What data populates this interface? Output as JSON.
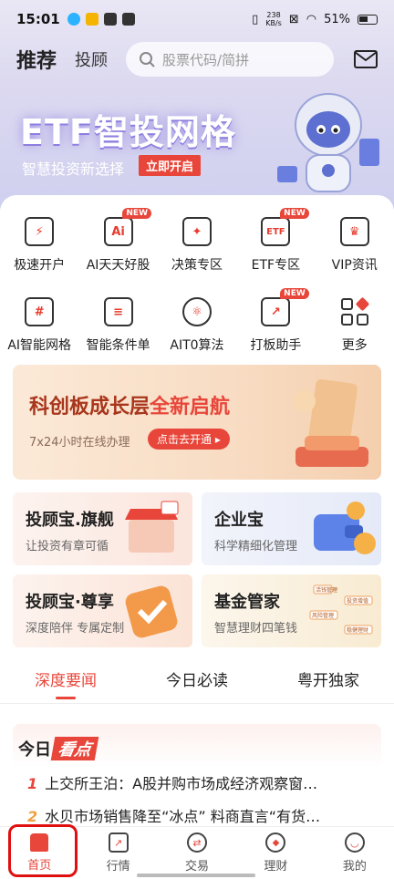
{
  "status_bar": {
    "time": "15:01",
    "net_speed": "238",
    "net_unit": "KB/s",
    "battery": "51%"
  },
  "top_nav": {
    "tab_recommend": "推荐",
    "tab_advisor": "投顾",
    "search_placeholder": "股票代码/简拼"
  },
  "banner": {
    "headline": "ETF智投网格",
    "subtitle": "智慧投资新选择",
    "cta": "立即开启"
  },
  "grid": [
    {
      "label": "极速开户",
      "icon": "lightning-icon",
      "badge": ""
    },
    {
      "label": "AI天天好股",
      "icon": "ai-icon",
      "badge": "NEW"
    },
    {
      "label": "决策专区",
      "icon": "lightbulb-icon",
      "badge": ""
    },
    {
      "label": "ETF专区",
      "icon": "etf-icon",
      "badge": "NEW"
    },
    {
      "label": "VIP资讯",
      "icon": "crown-icon",
      "badge": ""
    },
    {
      "label": "AI智能网格",
      "icon": "hash-grid-icon",
      "badge": ""
    },
    {
      "label": "智能条件单",
      "icon": "document-icon",
      "badge": ""
    },
    {
      "label": "AIT0算法",
      "icon": "atom-icon",
      "badge": ""
    },
    {
      "label": "打板助手",
      "icon": "chart-icon",
      "badge": "NEW"
    },
    {
      "label": "更多",
      "icon": "more-grid-icon",
      "badge": ""
    }
  ],
  "promo": {
    "title_a": "科创板成长层",
    "title_b": "全新启航",
    "subtitle": "7x24小时在线办理",
    "button": "点击去开通"
  },
  "cards": [
    {
      "title": "投顾宝.旗舰",
      "subtitle": "让投资有章可循"
    },
    {
      "title": "企业宝",
      "subtitle": "科学精细化管理"
    },
    {
      "title": "投顾宝·尊享",
      "subtitle": "深度陪伴 专属定制"
    },
    {
      "title": "基金管家",
      "subtitle": "智慧理财四笔钱"
    }
  ],
  "card_art_text": [
    "活钱管理",
    "投资增值",
    "风险管理",
    "稳健理财"
  ],
  "news_tabs": [
    "深度要闻",
    "今日必读",
    "粤开独家"
  ],
  "news": {
    "title_a": "今日",
    "title_b": "看点",
    "items": [
      {
        "num": "1",
        "text": "上交所王泊：A股并购市场成经济观察窗…"
      },
      {
        "num": "2",
        "text": "水贝市场销售降至“冰点” 料商直言“有货…"
      }
    ]
  },
  "tab_bar": [
    {
      "label": "首页",
      "icon": "home-icon"
    },
    {
      "label": "行情",
      "icon": "market-icon"
    },
    {
      "label": "交易",
      "icon": "trade-icon"
    },
    {
      "label": "理财",
      "icon": "wealth-icon"
    },
    {
      "label": "我的",
      "icon": "profile-icon"
    }
  ],
  "colors": {
    "accent": "#e8463a",
    "hero": "#dcd9f0"
  }
}
